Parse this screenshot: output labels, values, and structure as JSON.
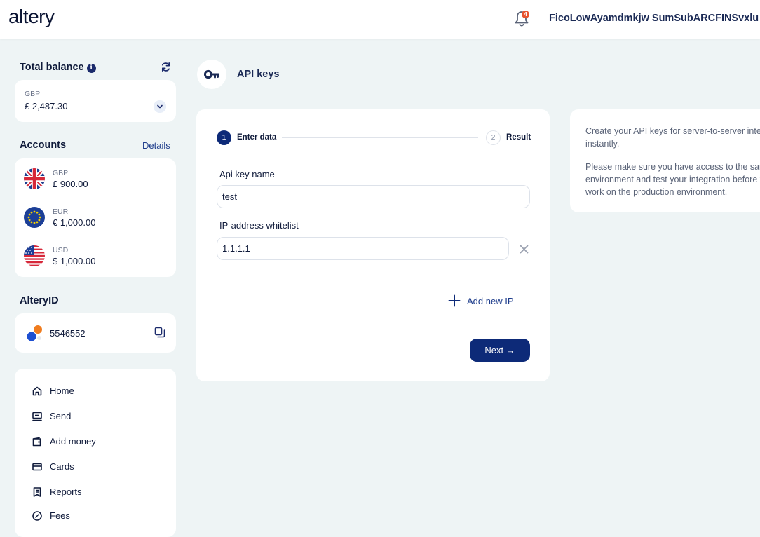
{
  "header": {
    "logo": "altery",
    "notification_count": "4",
    "username": "FicoLowAyamdmkjw SumSubARCFINSvxlu"
  },
  "sidebar": {
    "total_balance": {
      "title": "Total balance",
      "info": "i",
      "currency": "GBP",
      "amount": "£ 2,487.30"
    },
    "accounts": {
      "title": "Accounts",
      "details_link": "Details",
      "items": [
        {
          "currency": "GBP",
          "amount": "£ 900.00",
          "flag": "uk-flag-icon"
        },
        {
          "currency": "EUR",
          "amount": "€ 1,000.00",
          "flag": "eu-flag-icon"
        },
        {
          "currency": "USD",
          "amount": "$ 1,000.00",
          "flag": "us-flag-icon"
        }
      ]
    },
    "altery_id": {
      "title": "AlteryID",
      "value": "5546552"
    },
    "nav": [
      {
        "label": "Home",
        "icon": "home-icon"
      },
      {
        "label": "Send",
        "icon": "send-icon"
      },
      {
        "label": "Add money",
        "icon": "wallet-icon"
      },
      {
        "label": "Cards",
        "icon": "card-icon"
      },
      {
        "label": "Reports",
        "icon": "report-icon"
      },
      {
        "label": "Fees",
        "icon": "fees-icon"
      }
    ]
  },
  "page": {
    "title": "API keys",
    "icon": "key-icon"
  },
  "stepper": {
    "step1_num": "1",
    "step1_label": "Enter data",
    "step2_num": "2",
    "step2_label": "Result"
  },
  "form": {
    "api_key_label": "Api key name",
    "api_key_value": "test",
    "ip_label": "IP-address whitelist",
    "ip_value": "1.1.1.1",
    "add_ip_label": "Add new IP",
    "next_label": "Next →"
  },
  "info_panel": {
    "line1": "Create your API keys for server-to-server integration",
    "line2": "instantly.",
    "line3": "Please make sure you have access to the sandbox",
    "line4": "environment and test your integration before you",
    "line5": "work on the production environment."
  },
  "colors": {
    "accent": "#0d2a78",
    "badge": "#e8542f",
    "background": "#eef4f5"
  }
}
